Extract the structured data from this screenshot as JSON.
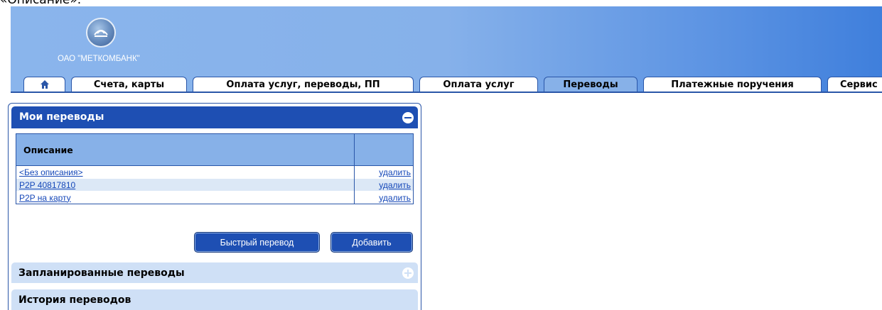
{
  "page_caption": "«Описание».",
  "bank": {
    "name": "ОАО \"МЕТКОМБАНК\""
  },
  "tabs": [
    {
      "label": "",
      "icon": "home-icon"
    },
    {
      "label": "Счета, карты"
    },
    {
      "label": "Оплата услуг, переводы, ПП"
    },
    {
      "label": "Оплата услуг"
    },
    {
      "label": "Переводы",
      "active": true
    },
    {
      "label": "Платежные поручения"
    },
    {
      "label": "Сервис"
    }
  ],
  "my_transfers": {
    "title": "Мои переводы",
    "column_description": "Описание",
    "rows": [
      {
        "description": "<Без описания>",
        "delete": "удалить"
      },
      {
        "description": "P2P 40817810",
        "delete": "удалить"
      },
      {
        "description": "P2P на карту",
        "delete": "удалить"
      }
    ],
    "quick_transfer_button": "Быстрый перевод",
    "add_button": "Добавить"
  },
  "scheduled_transfers": {
    "title": "Запланированные переводы"
  },
  "history": {
    "title": "История переводов"
  },
  "colors": {
    "header_gradient_start": "#8ab5ec",
    "header_gradient_end": "#3f7fdc",
    "accent": "#1e4fb3",
    "table_header": "#87b1e8",
    "row_alt": "#dce8f6",
    "link": "#1447b8"
  }
}
